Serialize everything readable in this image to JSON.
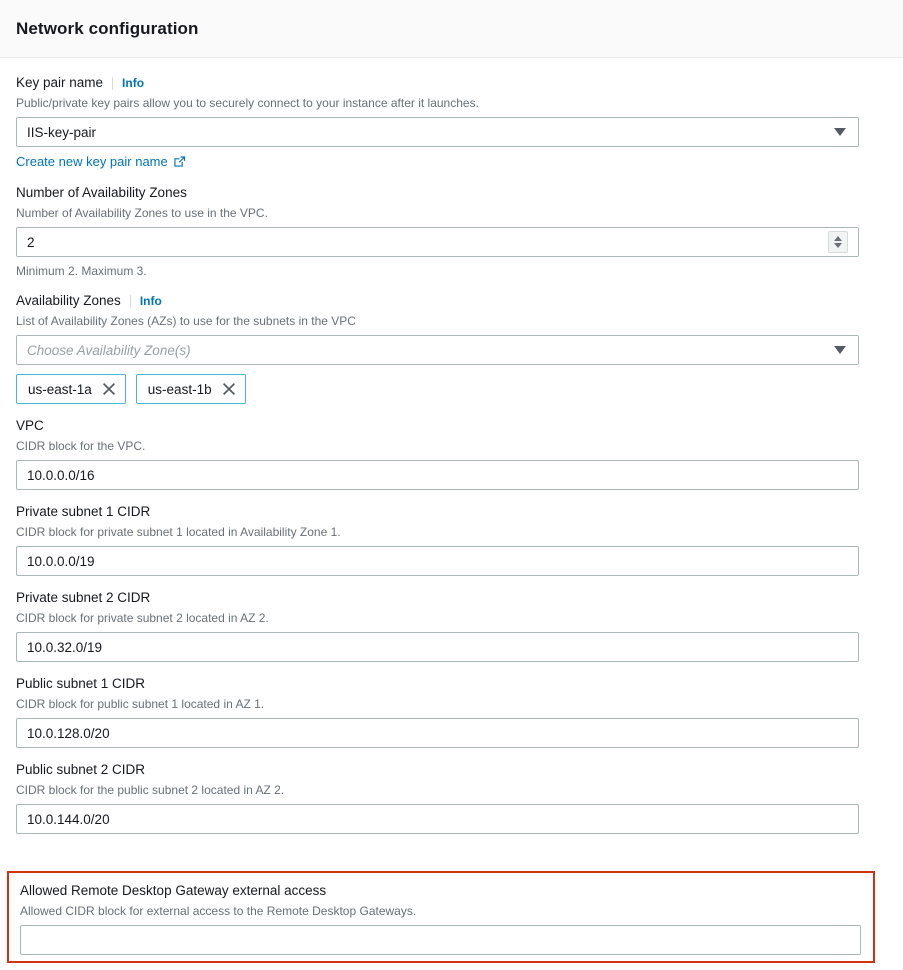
{
  "header": {
    "title": "Network configuration"
  },
  "fields": {
    "key_pair": {
      "label": "Key pair name",
      "info_label": "Info",
      "description": "Public/private key pairs allow you to securely connect to your instance after it launches.",
      "value": "IIS-key-pair",
      "create_link": "Create new key pair name",
      "caret_icon": "chevron-down-icon",
      "external_icon": "external-link-icon"
    },
    "az_count": {
      "label": "Number of Availability Zones",
      "description": "Number of Availability Zones to use in the VPC.",
      "value": "2",
      "hint": "Minimum 2. Maximum 3.",
      "stepper_icon": "up-down-stepper-icon"
    },
    "availability_zones": {
      "label": "Availability Zones",
      "info_label": "Info",
      "description": "List of Availability Zones (AZs) to use for the subnets in the VPC",
      "placeholder": "Choose Availability Zone(s)",
      "value": "",
      "caret_icon": "chevron-down-icon",
      "tokens": [
        {
          "label": "us-east-1a",
          "remove_icon": "close-icon"
        },
        {
          "label": "us-east-1b",
          "remove_icon": "close-icon"
        }
      ]
    },
    "vpc": {
      "label": "VPC",
      "description": "CIDR block for the VPC.",
      "value": "10.0.0.0/16"
    },
    "private_subnet_1": {
      "label": "Private subnet 1 CIDR",
      "description": "CIDR block for private subnet 1 located in Availability Zone 1.",
      "value": "10.0.0.0/19"
    },
    "private_subnet_2": {
      "label": "Private subnet 2 CIDR",
      "description": "CIDR block for private subnet 2 located in AZ 2.",
      "value": "10.0.32.0/19"
    },
    "public_subnet_1": {
      "label": "Public subnet 1 CIDR",
      "description": "CIDR block for public subnet 1 located in AZ 1.",
      "value": "10.0.128.0/20"
    },
    "public_subnet_2": {
      "label": "Public subnet 2 CIDR",
      "description": "CIDR block for the public subnet 2 located in AZ 2.",
      "value": "10.0.144.0/20"
    },
    "rdgw_external_access": {
      "label": "Allowed Remote Desktop Gateway external access",
      "description": "Allowed CIDR block for external access to the Remote Desktop Gateways.",
      "value": "",
      "error_highlighted": true
    }
  },
  "colors": {
    "link": "#0073bb",
    "error_border": "#d13212",
    "token_border": "#44b9d6",
    "input_border": "#aab7b8",
    "text": "#16191f",
    "muted_text": "#687078",
    "header_bg": "#fafafa"
  }
}
